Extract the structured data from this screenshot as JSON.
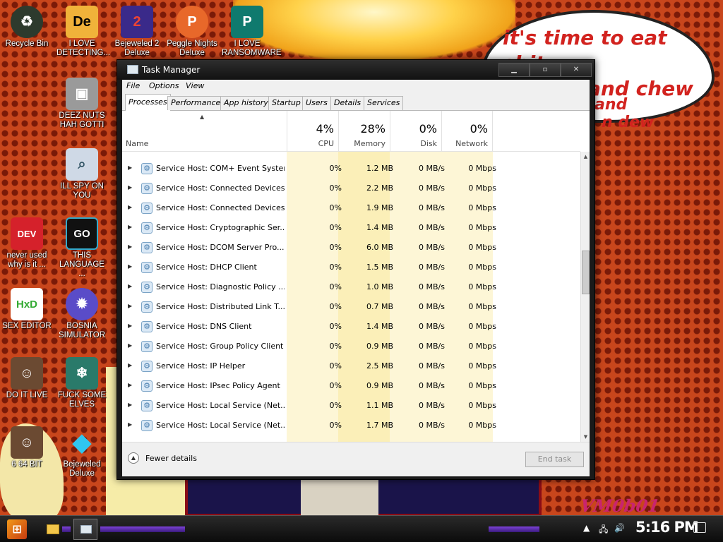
{
  "wallpaper": {
    "speech_bubble": [
      "it's time to eat shit",
      "and chew",
      "and",
      "n dew"
    ],
    "brand_text": "VM0b01"
  },
  "desktop_icons": [
    {
      "label": "Recycle Bin",
      "icon": "recycle-bin-icon"
    },
    {
      "label": "I LOVE DETECTING...",
      "icon": "de-app-icon"
    },
    {
      "label": "Bejeweled 2 Deluxe",
      "icon": "bejeweled2-icon"
    },
    {
      "label": "Peggle Nights Deluxe",
      "icon": "peggle-icon"
    },
    {
      "label": "I LOVE RANSOMWARE",
      "icon": "publisher-icon"
    },
    {
      "label": "DEEZ NUTS HAH GOTTI",
      "icon": "windows-stack-icon"
    },
    {
      "label": "ILL SPY ON YOU",
      "icon": "network-spy-icon"
    },
    {
      "label": "never used why is it ...",
      "icon": "devcpp-icon"
    },
    {
      "label": "THIS LANGUAGE ...",
      "icon": "go-ide-icon"
    },
    {
      "label": "SEX EDITOR",
      "icon": "hxd-icon"
    },
    {
      "label": "BOSNIA SIMULATOR",
      "icon": "mine-icon"
    },
    {
      "label": "DO IT LIVE",
      "icon": "portrait-icon"
    },
    {
      "label": "FUCK SOME ELVES",
      "icon": "game-elves-icon"
    },
    {
      "label": "6 64 BIT",
      "icon": "portrait2-icon"
    },
    {
      "label": "Bejeweled Deluxe",
      "icon": "diamond-icon"
    }
  ],
  "window": {
    "title": "Task Manager",
    "menu": [
      "File",
      "Options",
      "View"
    ],
    "tabs": [
      "Processes",
      "Performance",
      "App history",
      "Startup",
      "Users",
      "Details",
      "Services"
    ],
    "active_tab": "Processes",
    "columns": {
      "name": "Name",
      "cpu": {
        "pct": "4%",
        "label": "CPU"
      },
      "memory": {
        "pct": "28%",
        "label": "Memory"
      },
      "disk": {
        "pct": "0%",
        "label": "Disk"
      },
      "network": {
        "pct": "0%",
        "label": "Network"
      }
    },
    "processes": [
      {
        "name": "Service Host: COM+ Event System",
        "cpu": "0%",
        "memory": "1.2 MB",
        "disk": "0 MB/s",
        "network": "0 Mbps"
      },
      {
        "name": "Service Host: Connected Devices...",
        "cpu": "0%",
        "memory": "2.2 MB",
        "disk": "0 MB/s",
        "network": "0 Mbps"
      },
      {
        "name": "Service Host: Connected Devices...",
        "cpu": "0%",
        "memory": "1.9 MB",
        "disk": "0 MB/s",
        "network": "0 Mbps"
      },
      {
        "name": "Service Host: Cryptographic Ser...",
        "cpu": "0%",
        "memory": "1.4 MB",
        "disk": "0 MB/s",
        "network": "0 Mbps"
      },
      {
        "name": "Service Host: DCOM Server Pro...",
        "cpu": "0%",
        "memory": "6.0 MB",
        "disk": "0 MB/s",
        "network": "0 Mbps"
      },
      {
        "name": "Service Host: DHCP Client",
        "cpu": "0%",
        "memory": "1.5 MB",
        "disk": "0 MB/s",
        "network": "0 Mbps"
      },
      {
        "name": "Service Host: Diagnostic Policy ...",
        "cpu": "0%",
        "memory": "1.0 MB",
        "disk": "0 MB/s",
        "network": "0 Mbps"
      },
      {
        "name": "Service Host: Distributed Link T...",
        "cpu": "0%",
        "memory": "0.7 MB",
        "disk": "0 MB/s",
        "network": "0 Mbps"
      },
      {
        "name": "Service Host: DNS Client",
        "cpu": "0%",
        "memory": "1.4 MB",
        "disk": "0 MB/s",
        "network": "0 Mbps"
      },
      {
        "name": "Service Host: Group Policy Client",
        "cpu": "0%",
        "memory": "0.9 MB",
        "disk": "0 MB/s",
        "network": "0 Mbps"
      },
      {
        "name": "Service Host: IP Helper",
        "cpu": "0%",
        "memory": "2.5 MB",
        "disk": "0 MB/s",
        "network": "0 Mbps"
      },
      {
        "name": "Service Host: IPsec Policy Agent",
        "cpu": "0%",
        "memory": "0.9 MB",
        "disk": "0 MB/s",
        "network": "0 Mbps"
      },
      {
        "name": "Service Host: Local Service (Net...",
        "cpu": "0%",
        "memory": "1.1 MB",
        "disk": "0 MB/s",
        "network": "0 Mbps"
      },
      {
        "name": "Service Host: Local Service (Net...",
        "cpu": "0%",
        "memory": "1.7 MB",
        "disk": "0 MB/s",
        "network": "0 Mbps"
      }
    ],
    "footer": {
      "fewer_details": "Fewer details",
      "end_task": "End task"
    }
  },
  "taskbar": {
    "clock": "5:16 PM",
    "apps": [
      "File Explorer",
      "Task Manager"
    ]
  },
  "colors": {
    "cpu_column_tint": "#fdf6d6",
    "memory_column_tint": "#fbefb8",
    "wallpaper_orange": "#c8461c",
    "taskbar_accent": "#7d42d8"
  }
}
